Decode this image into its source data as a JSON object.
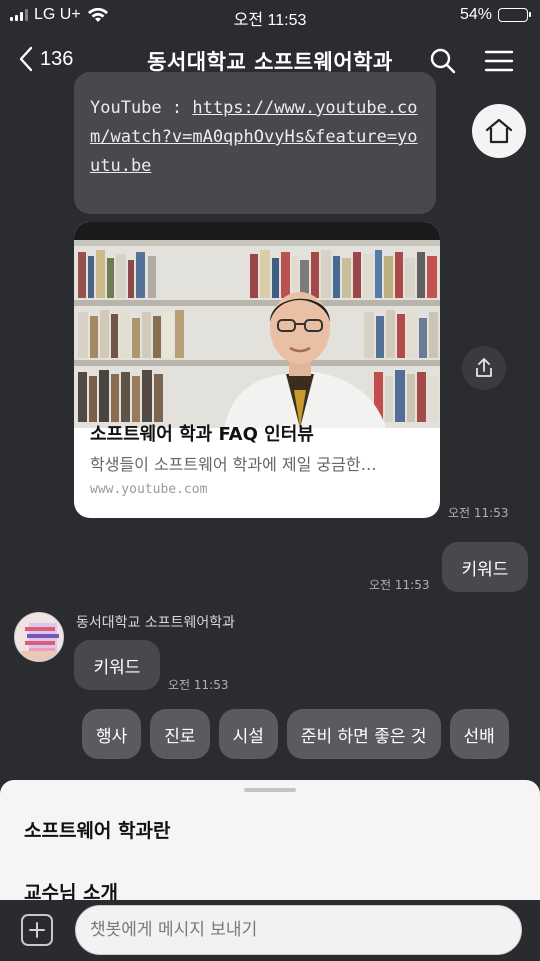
{
  "status_bar": {
    "carrier": "LG U+",
    "time": "오전 11:53",
    "battery": "54%",
    "battery_level": 0.54
  },
  "header": {
    "back_count": "136",
    "title": "동서대학교 소프트웨어학과",
    "icons": [
      "chevron-left-icon",
      "search-icon",
      "menu-icon"
    ]
  },
  "link_message": {
    "prefix": "YouTube : ",
    "url": "https://www.youtube.com/watch?v=mA0qphOvyHs&feature=youtu.be"
  },
  "card": {
    "title": "소프트웨어 학과 FAQ 인터뷰",
    "description": "학생들이 소프트웨어 학과에 제일 궁금한…",
    "domain": "www.youtube.com"
  },
  "messages": {
    "card_time": "오전 11:53",
    "user_text": "키워드",
    "user_time": "오전 11:53",
    "bot_sender": "동서대학교 소프트웨어학과",
    "bot_text": "키워드",
    "bot_time": "오전 11:53"
  },
  "quick_replies": [
    "행사",
    "진로",
    "시설",
    "준비 하면 좋은 것",
    "선배"
  ],
  "sheet": {
    "items": [
      "소프트웨어 학과란",
      "교수님 소개"
    ]
  },
  "input": {
    "placeholder": "챗봇에게 메시지 보내기"
  },
  "colors": {
    "background": "#2b2c30",
    "bubble": "#48494e",
    "chip": "#5a5b60",
    "sheet": "#f5f5f5"
  }
}
